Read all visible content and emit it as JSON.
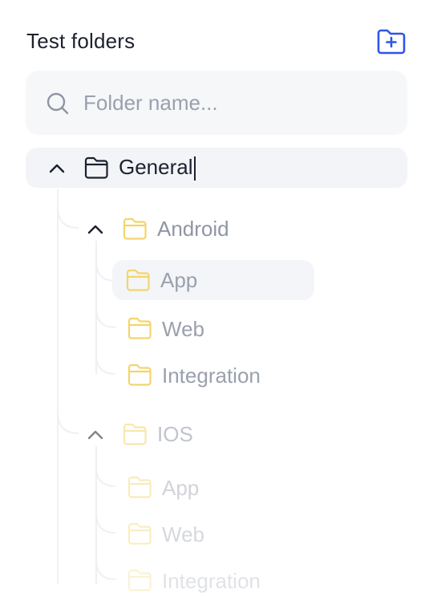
{
  "panel": {
    "title": "Test folders",
    "add_folder_icon": "folder-plus-icon",
    "accent": "#2e55e6"
  },
  "search": {
    "placeholder": "Folder name...",
    "value": "",
    "icon": "search-icon"
  },
  "tree": {
    "root": {
      "label": "General",
      "expanded": true,
      "editing": true
    },
    "groups": [
      {
        "label": "Android",
        "expanded": true,
        "items": [
          {
            "label": "App",
            "selected": true
          },
          {
            "label": "Web",
            "selected": false
          },
          {
            "label": "Integration",
            "selected": false
          }
        ]
      },
      {
        "label": "IOS",
        "expanded": true,
        "items": [
          {
            "label": "App",
            "selected": false
          },
          {
            "label": "Web",
            "selected": false
          },
          {
            "label": "Integration",
            "selected": false
          }
        ]
      }
    ],
    "folder_color": "#f2d56b"
  }
}
